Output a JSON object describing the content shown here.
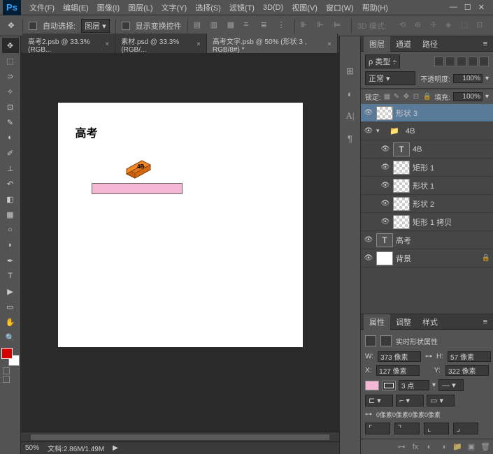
{
  "app": {
    "logo": "Ps"
  },
  "menu": {
    "file": "文件(F)",
    "edit": "编辑(E)",
    "image": "图像(I)",
    "layer": "图层(L)",
    "type": "文字(Y)",
    "select": "选择(S)",
    "filter": "滤镜(T)",
    "threed": "3D(D)",
    "view": "视图(V)",
    "window": "窗口(W)",
    "help": "帮助(H)"
  },
  "options": {
    "auto_select": "自动选择:",
    "auto_select_mode": "图层",
    "show_transform": "显示变换控件",
    "threed_mode": "3D 模式:"
  },
  "tabs": [
    {
      "title": "高考2.psb @ 33.3%(RGB..."
    },
    {
      "title": "素材.psd @ 33.3%(RGB/..."
    },
    {
      "title": "高考文字.psb @ 50% (形状 3 , RGB/8#) *"
    }
  ],
  "canvas": {
    "text": "高考",
    "eraser_label": "4B"
  },
  "status": {
    "zoom": "50%",
    "doc": "文档:2.86M/1.49M"
  },
  "panels": {
    "layers_tab": "图层",
    "channels_tab": "通道",
    "paths_tab": "路径",
    "kind_label": "ρ 类型",
    "blend_mode": "正常",
    "opacity_label": "不透明度:",
    "opacity_value": "100%",
    "lock_label": "锁定:",
    "fill_label": "填充:",
    "fill_value": "100%"
  },
  "layers": {
    "shape3": "形状 3",
    "group4b": "4B",
    "text4b": "4B",
    "rect1": "矩形 1",
    "shape1": "形状 1",
    "shape2": "形状 2",
    "rect1copy": "矩形 1 拷贝",
    "gaokao": "高考",
    "background": "背景"
  },
  "props": {
    "tab_props": "属性",
    "tab_adjust": "调整",
    "tab_styles": "样式",
    "title": "实时形状属性",
    "w_label": "W:",
    "w_value": "373 像素",
    "h_label": "H:",
    "h_value": "57 像素",
    "x_label": "X:",
    "x_value": "127 像素",
    "y_label": "Y:",
    "y_value": "322 像素",
    "stroke_width": "3 点",
    "corners": "0像素0像素0像素0像素"
  }
}
